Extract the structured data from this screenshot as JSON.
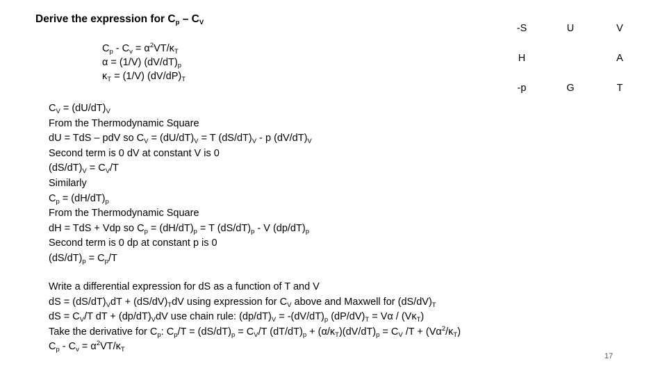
{
  "slide": {
    "title": [
      {
        "t": "Derive the expression for C"
      },
      {
        "t": "p",
        "s": "sub"
      },
      {
        "t": " – C"
      },
      {
        "t": "V",
        "s": "sub"
      }
    ],
    "formulas": [
      [
        {
          "t": "C"
        },
        {
          "t": "p",
          "s": "sub"
        },
        {
          "t": " - C"
        },
        {
          "t": "v",
          "s": "sub"
        },
        {
          "t": " = α"
        },
        {
          "t": "2",
          "s": "sup"
        },
        {
          "t": "VT/κ"
        },
        {
          "t": "T",
          "s": "sub"
        }
      ],
      [
        {
          "t": "α = (1/V) (dV/dT)"
        },
        {
          "t": "p",
          "s": "sub"
        }
      ],
      [
        {
          "t": "κ"
        },
        {
          "t": "T",
          "s": "sub"
        },
        {
          "t": " = (1/V) (dV/dP)"
        },
        {
          "t": "T",
          "s": "sub"
        }
      ]
    ],
    "thermodynamic_square": {
      "cells": [
        {
          "label": "-S",
          "row": 0,
          "col": 0
        },
        {
          "label": "U",
          "row": 0,
          "col": 1
        },
        {
          "label": "V",
          "row": 0,
          "col": 2
        },
        {
          "label": "H",
          "row": 1,
          "col": 0
        },
        {
          "label": "A",
          "row": 1,
          "col": 2
        },
        {
          "label": "-p",
          "row": 2,
          "col": 0
        },
        {
          "label": "G",
          "row": 2,
          "col": 1
        },
        {
          "label": "T",
          "row": 2,
          "col": 2
        }
      ]
    },
    "body1": [
      [
        {
          "t": "C"
        },
        {
          "t": "V",
          "s": "sub"
        },
        {
          "t": " = (dU/dT)"
        },
        {
          "t": "V",
          "s": "sub"
        }
      ],
      [
        {
          "t": "From the Thermodynamic Square"
        }
      ],
      [
        {
          "t": "dU = TdS – pdV so C"
        },
        {
          "t": "V",
          "s": "sub"
        },
        {
          "t": " = (dU/dT)"
        },
        {
          "t": "V",
          "s": "sub"
        },
        {
          "t": " = T (dS/dT)"
        },
        {
          "t": "V",
          "s": "sub"
        },
        {
          "t": " - p (dV/dT)"
        },
        {
          "t": "V",
          "s": "sub"
        }
      ],
      [
        {
          "t": "Second term is 0 dV at constant V is 0"
        }
      ],
      [
        {
          "t": " (dS/dT)"
        },
        {
          "t": "V",
          "s": "sub"
        },
        {
          "t": " = C"
        },
        {
          "t": "V",
          "s": "sub"
        },
        {
          "t": "/T"
        }
      ],
      [
        {
          "t": "Similarly"
        }
      ],
      [
        {
          "t": "C"
        },
        {
          "t": "p",
          "s": "sub"
        },
        {
          "t": " = (dH/dT)"
        },
        {
          "t": "p",
          "s": "sub"
        }
      ],
      [
        {
          "t": "From the Thermodynamic Square"
        }
      ],
      [
        {
          "t": "dH = TdS + Vdp so C"
        },
        {
          "t": "p",
          "s": "sub"
        },
        {
          "t": " = (dH/dT)"
        },
        {
          "t": "p",
          "s": "sub"
        },
        {
          "t": " = T (dS/dT)"
        },
        {
          "t": "p",
          "s": "sub"
        },
        {
          "t": " - V (dp/dT)"
        },
        {
          "t": "p",
          "s": "sub"
        }
      ],
      [
        {
          "t": "Second term is 0 dp at constant p is 0"
        }
      ],
      [
        {
          "t": " (dS/dT)"
        },
        {
          "t": "p",
          "s": "sub"
        },
        {
          "t": " = C"
        },
        {
          "t": "p",
          "s": "sub"
        },
        {
          "t": "/T"
        }
      ]
    ],
    "body2": [
      [
        {
          "t": "Write a differential expression for dS as a function of T and V"
        }
      ],
      [
        {
          "t": "dS = (dS/dT)"
        },
        {
          "t": "V",
          "s": "sub"
        },
        {
          "t": "dT + (dS/dV)"
        },
        {
          "t": "T",
          "s": "sub"
        },
        {
          "t": "dV using expression for C"
        },
        {
          "t": "V",
          "s": "sub"
        },
        {
          "t": " above and Maxwell for (dS/dV)"
        },
        {
          "t": "T",
          "s": "sub"
        }
      ],
      [
        {
          "t": "dS = C"
        },
        {
          "t": "V",
          "s": "sub"
        },
        {
          "t": "/T dT + (dp/dT)"
        },
        {
          "t": "V",
          "s": "sub"
        },
        {
          "t": "dV use chain rule: (dp/dT)"
        },
        {
          "t": "V",
          "s": "sub"
        },
        {
          "t": " = -(dV/dT)"
        },
        {
          "t": "p",
          "s": "sub"
        },
        {
          "t": " (dP/dV)"
        },
        {
          "t": "T",
          "s": "sub"
        },
        {
          "t": " = Vα / (Vκ"
        },
        {
          "t": "T",
          "s": "sub"
        },
        {
          "t": ")"
        }
      ],
      [
        {
          "t": "Take the derivative for C"
        },
        {
          "t": "p",
          "s": "sub"
        },
        {
          "t": ": C"
        },
        {
          "t": "p",
          "s": "sub"
        },
        {
          "t": "/T = (dS/dT)"
        },
        {
          "t": "p",
          "s": "sub"
        },
        {
          "t": " = C"
        },
        {
          "t": "V",
          "s": "sub"
        },
        {
          "t": "/T (dT/dT)"
        },
        {
          "t": "p",
          "s": "sub"
        },
        {
          "t": " + (α/κ"
        },
        {
          "t": "T",
          "s": "sub"
        },
        {
          "t": ")(dV/dT)"
        },
        {
          "t": "p",
          "s": "sub"
        },
        {
          "t": " = C"
        },
        {
          "t": "V",
          "s": "sub"
        },
        {
          "t": " /T + (Vα"
        },
        {
          "t": "2",
          "s": "sup"
        },
        {
          "t": "/κ"
        },
        {
          "t": "T",
          "s": "sub"
        },
        {
          "t": ")"
        }
      ],
      [
        {
          "t": "C"
        },
        {
          "t": "p",
          "s": "sub"
        },
        {
          "t": " - C"
        },
        {
          "t": "v",
          "s": "sub"
        },
        {
          "t": " = α"
        },
        {
          "t": "2",
          "s": "sup"
        },
        {
          "t": "VT/κ"
        },
        {
          "t": "T",
          "s": "sub"
        }
      ]
    ],
    "page_number": "17"
  }
}
